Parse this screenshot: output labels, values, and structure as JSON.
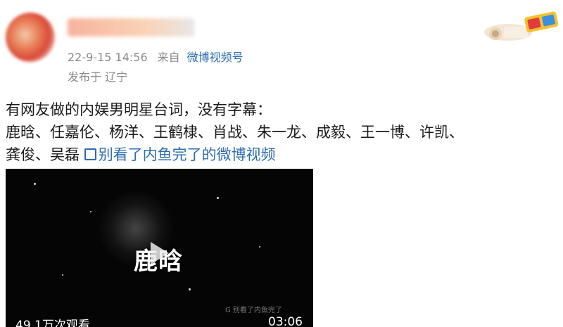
{
  "post": {
    "username": "",
    "timestamp": "22-9-15 14:56",
    "from_label": "来自",
    "source": "微博视频号",
    "location": "发布于 辽宁",
    "text_line1": "有网友做的内娱男明星台词，没有字幕：",
    "text_line2": "鹿晗、任嘉伦、杨洋、王鹤棣、肖战、朱一龙、成毅、王一博、许凯、",
    "text_line3": "龚俊、吴磊 ",
    "video_link": "别看了内鱼完了的微博视频"
  },
  "video": {
    "overlay_title": "鹿晗",
    "watermark": "G 别看了内鱼完了",
    "views": "49.1万次观看",
    "duration": "03:06"
  },
  "colors": {
    "link": "#2b6cb0",
    "meta": "#8a8a8a",
    "video_bg": "#050505"
  }
}
